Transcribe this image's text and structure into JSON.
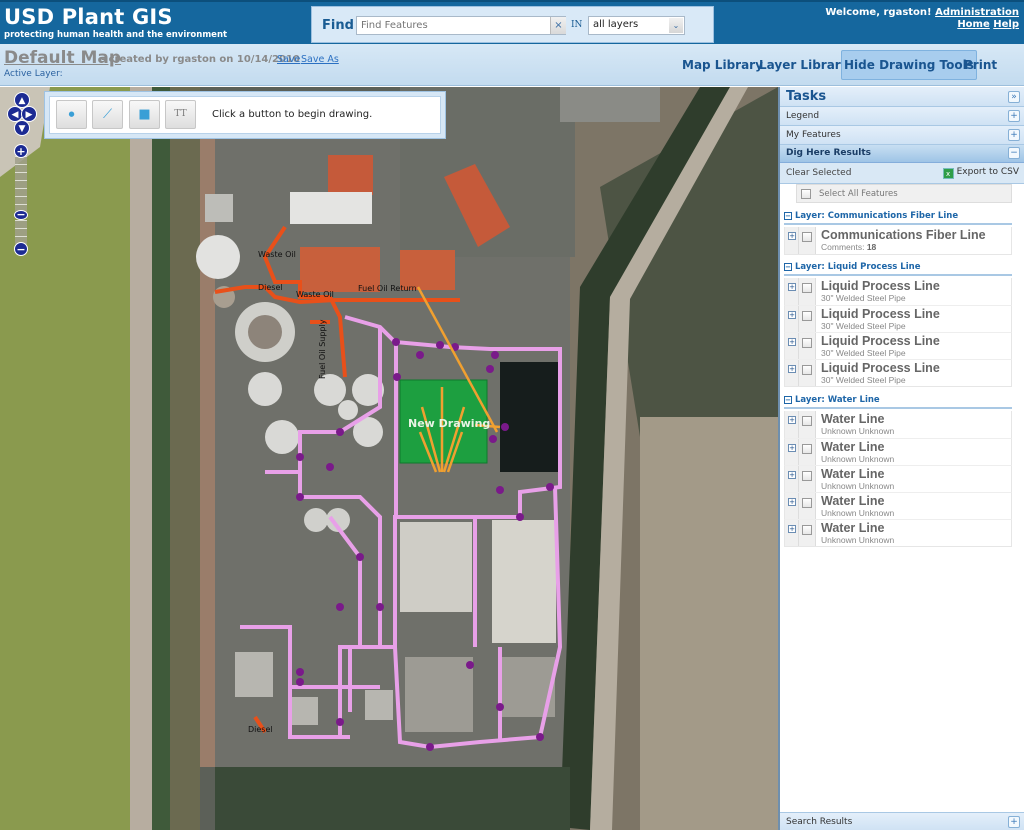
{
  "header": {
    "title": "USD Plant GIS",
    "tagline": "protecting human health and the environment",
    "find": {
      "label": "Find",
      "placeholder": "Find Features",
      "value": "",
      "clear_icon": "×",
      "in_label": "IN",
      "layer_select_value": "all layers",
      "select_arrow_icon": "⌄"
    },
    "user": {
      "welcome": "Welcome, rgaston!",
      "links": [
        "Administration",
        "Home",
        "Help"
      ]
    }
  },
  "subheader": {
    "map_name": "Default Map",
    "meta": "- created by rgaston on 10/14/2010",
    "save_label": "Save",
    "save_as_label": "Save As",
    "active_layer_label": "Active Layer:",
    "nav": [
      "Map Library",
      "Layer Library",
      "Hide Drawing Tools",
      "Print Map"
    ]
  },
  "map": {
    "controls": {
      "pan_up": "▲",
      "pan_left": "◀",
      "pan_right": "▶",
      "pan_down": "▼",
      "zoom_in": "+",
      "zoom_out": "−"
    },
    "drawing_toolbar": {
      "tools": [
        {
          "name": "point-tool",
          "glyph": "●"
        },
        {
          "name": "polyline-tool",
          "glyph": "⟋"
        },
        {
          "name": "polygon-tool",
          "glyph": "■"
        },
        {
          "name": "text-tool",
          "glyph": "TT"
        }
      ],
      "hint": "Click a button to begin drawing."
    },
    "labels": {
      "waste_oil_1": "Waste Oil",
      "diesel_1": "Diesel",
      "waste_oil_2": "Waste Oil",
      "fuel_oil_return": "Fuel Oil Return",
      "fuel_oil_supply": "Fuel Oil Supply",
      "new_drawing": "New Drawing",
      "diesel_2": "Diesel"
    },
    "colors": {
      "process_line": "#e8a0e8",
      "fuel_line": "#e8501a",
      "drawing_line": "#f0a030",
      "drawing_fill": "#12a53a",
      "node": "#7a1a8a"
    }
  },
  "side_panel": {
    "tasks_title": "Tasks",
    "collapse_icon": "»",
    "sections": {
      "legend": "Legend",
      "my_features": "My Features",
      "dig_here": "Dig Here Results",
      "search_results": "Search Results"
    },
    "clear_selected": "Clear Selected",
    "export_csv": "Export to CSV",
    "select_all": "Select All Features",
    "groups": [
      {
        "title": "Layer: Communications Fiber Line",
        "features": [
          {
            "name": "Communications Fiber Line",
            "desc_label": "Comments: ",
            "desc_value": "18"
          }
        ]
      },
      {
        "title": "Layer: Liquid Process Line",
        "features": [
          {
            "name": "Liquid Process Line",
            "desc_label": "30\" Welded Steel Pipe",
            "desc_value": ""
          },
          {
            "name": "Liquid Process Line",
            "desc_label": "30\" Welded Steel Pipe",
            "desc_value": ""
          },
          {
            "name": "Liquid Process Line",
            "desc_label": "30\" Welded Steel Pipe",
            "desc_value": ""
          },
          {
            "name": "Liquid Process Line",
            "desc_label": "30\" Welded Steel Pipe",
            "desc_value": ""
          }
        ]
      },
      {
        "title": "Layer: Water Line",
        "features": [
          {
            "name": "Water Line",
            "desc_label": "Unknown Unknown",
            "desc_value": ""
          },
          {
            "name": "Water Line",
            "desc_label": "Unknown Unknown",
            "desc_value": ""
          },
          {
            "name": "Water Line",
            "desc_label": "Unknown Unknown",
            "desc_value": ""
          },
          {
            "name": "Water Line",
            "desc_label": "Unknown Unknown",
            "desc_value": ""
          },
          {
            "name": "Water Line",
            "desc_label": "Unknown Unknown",
            "desc_value": ""
          }
        ]
      }
    ]
  }
}
